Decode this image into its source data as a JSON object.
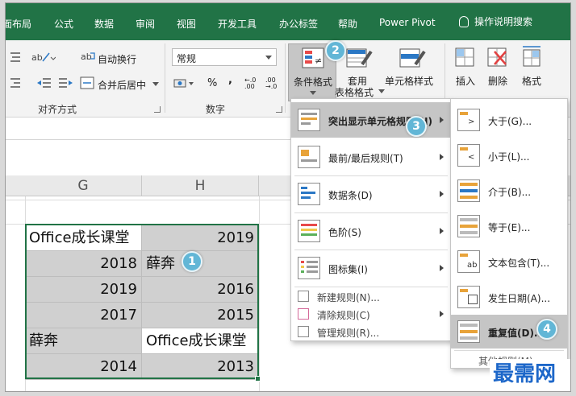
{
  "tabs": [
    "页面布局",
    "公式",
    "数据",
    "审阅",
    "视图",
    "开发工具",
    "办公标签",
    "帮助",
    "Power Pivot"
  ],
  "tell_me": "操作说明搜索",
  "ribbon": {
    "wrap_text": "自动换行",
    "merge_center": "合并后居中",
    "number_format": "常规",
    "percent": "%",
    "comma": ",",
    "decimal_inc": "←.0 .00",
    "decimal_dec": ".00 →.0",
    "conditional_format": "条件格式",
    "format_as_table_1": "套用",
    "format_as_table_2": "表格格式",
    "cell_styles": "单元格样式",
    "insert": "插入",
    "delete": "删除",
    "format": "格式",
    "group_alignment": "对齐方式",
    "group_number": "数字"
  },
  "columns": [
    "G",
    "H"
  ],
  "cells": [
    [
      "Office成长课堂",
      "2019"
    ],
    [
      "2018",
      "薛奔"
    ],
    [
      "2019",
      "2016"
    ],
    [
      "2017",
      "2015"
    ],
    [
      "薛奔",
      "Office成长课堂"
    ],
    [
      "2014",
      "2013"
    ]
  ],
  "badges": [
    "1",
    "2",
    "3",
    "4"
  ],
  "cf_menu": {
    "items": [
      {
        "label": "突出显示单元格规则(H)"
      },
      {
        "label": "最前/最后规则(T)"
      },
      {
        "label": "数据条(D)"
      },
      {
        "label": "色阶(S)"
      },
      {
        "label": "图标集(I)"
      }
    ],
    "small_items": [
      {
        "label": "新建规则(N)..."
      },
      {
        "label": "清除规则(C)"
      },
      {
        "label": "管理规则(R)..."
      }
    ]
  },
  "sub_menu": {
    "items": [
      {
        "label": "大于(G)..."
      },
      {
        "label": "小于(L)..."
      },
      {
        "label": "介于(B)..."
      },
      {
        "label": "等于(E)..."
      },
      {
        "label": "文本包含(T)..."
      },
      {
        "label": "发生日期(A)..."
      },
      {
        "label": "重复值(D)..."
      }
    ],
    "more": "其他规则(M)..."
  },
  "watermark": "最需网",
  "colors": {
    "accent": "#217346",
    "badge": "#62b6d6",
    "highlight": "#c5c5c5",
    "watermark": "#1d67c9"
  }
}
